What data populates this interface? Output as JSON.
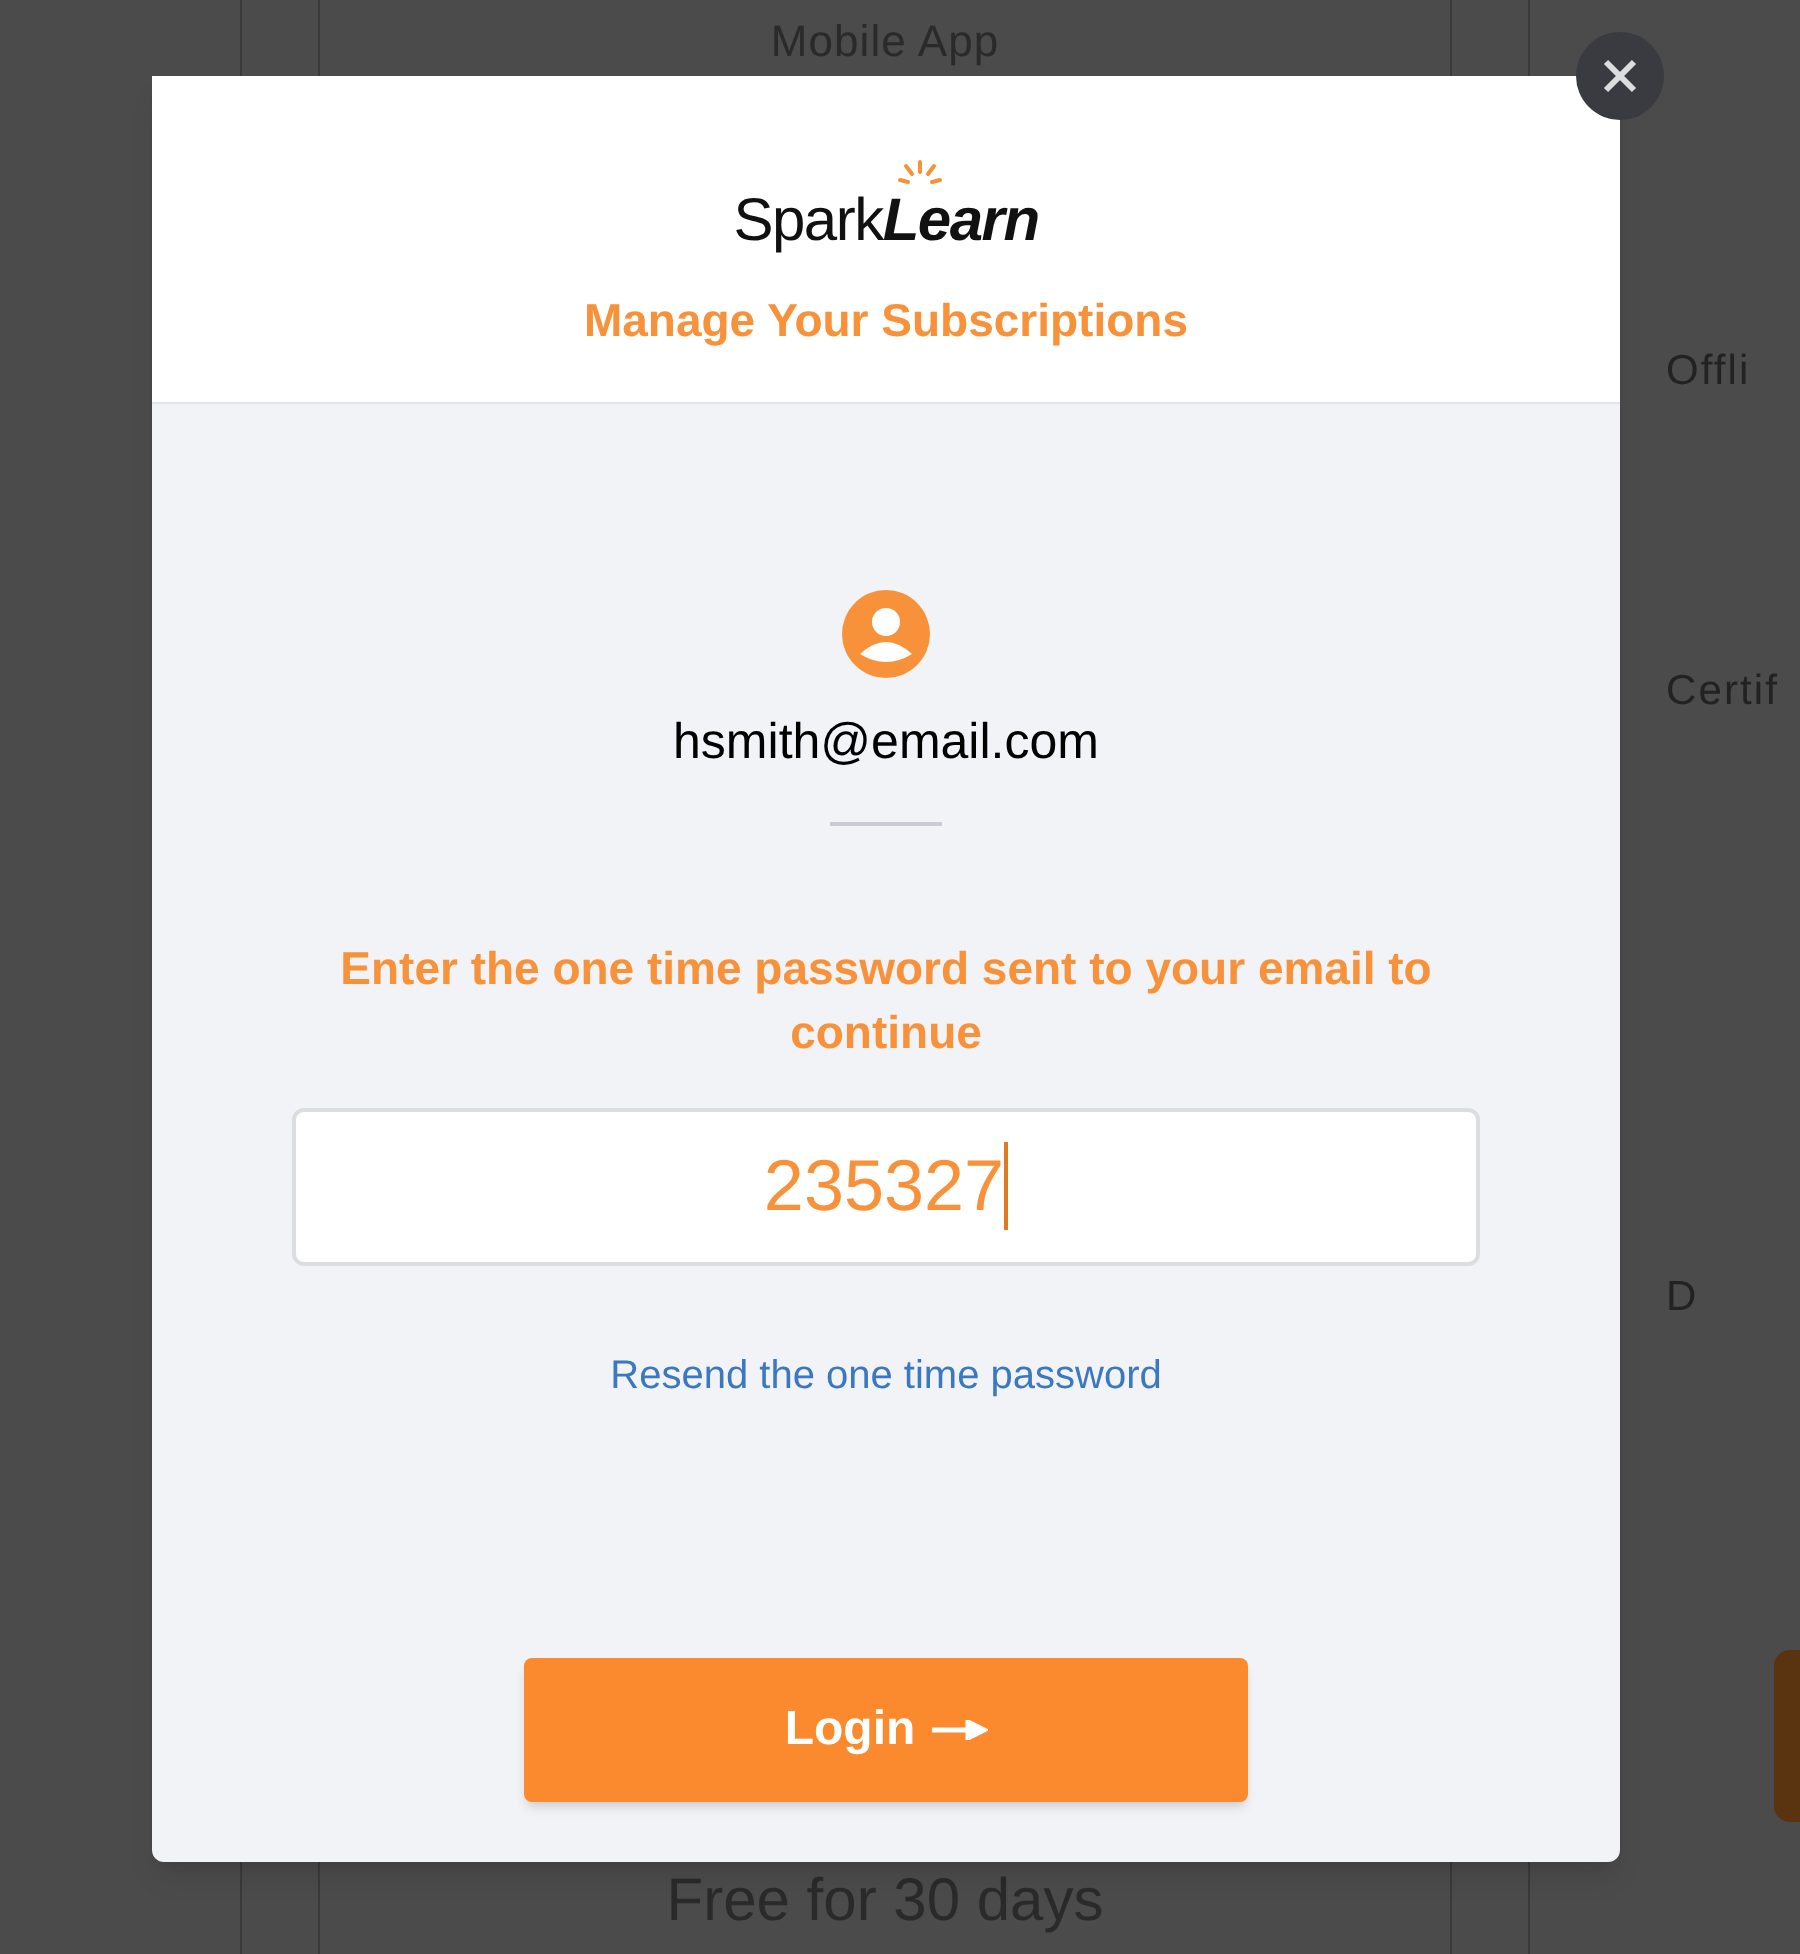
{
  "background": {
    "top_label": "Mobile App",
    "right_labels": [
      "Offli",
      "Certif",
      "D"
    ],
    "bottom_label": "Free for 30 days"
  },
  "modal": {
    "logo": "Spark**Learn**",
    "title": "Manage Your Subscriptions",
    "email": "hsmith@email.com",
    "instruction": "Enter the one time password sent to your email to continue",
    "otp_field": {
      "value": "235327",
      "focused": true
    },
    "resend_link": "Resend the one time password",
    "login_button": "Login"
  }
}
